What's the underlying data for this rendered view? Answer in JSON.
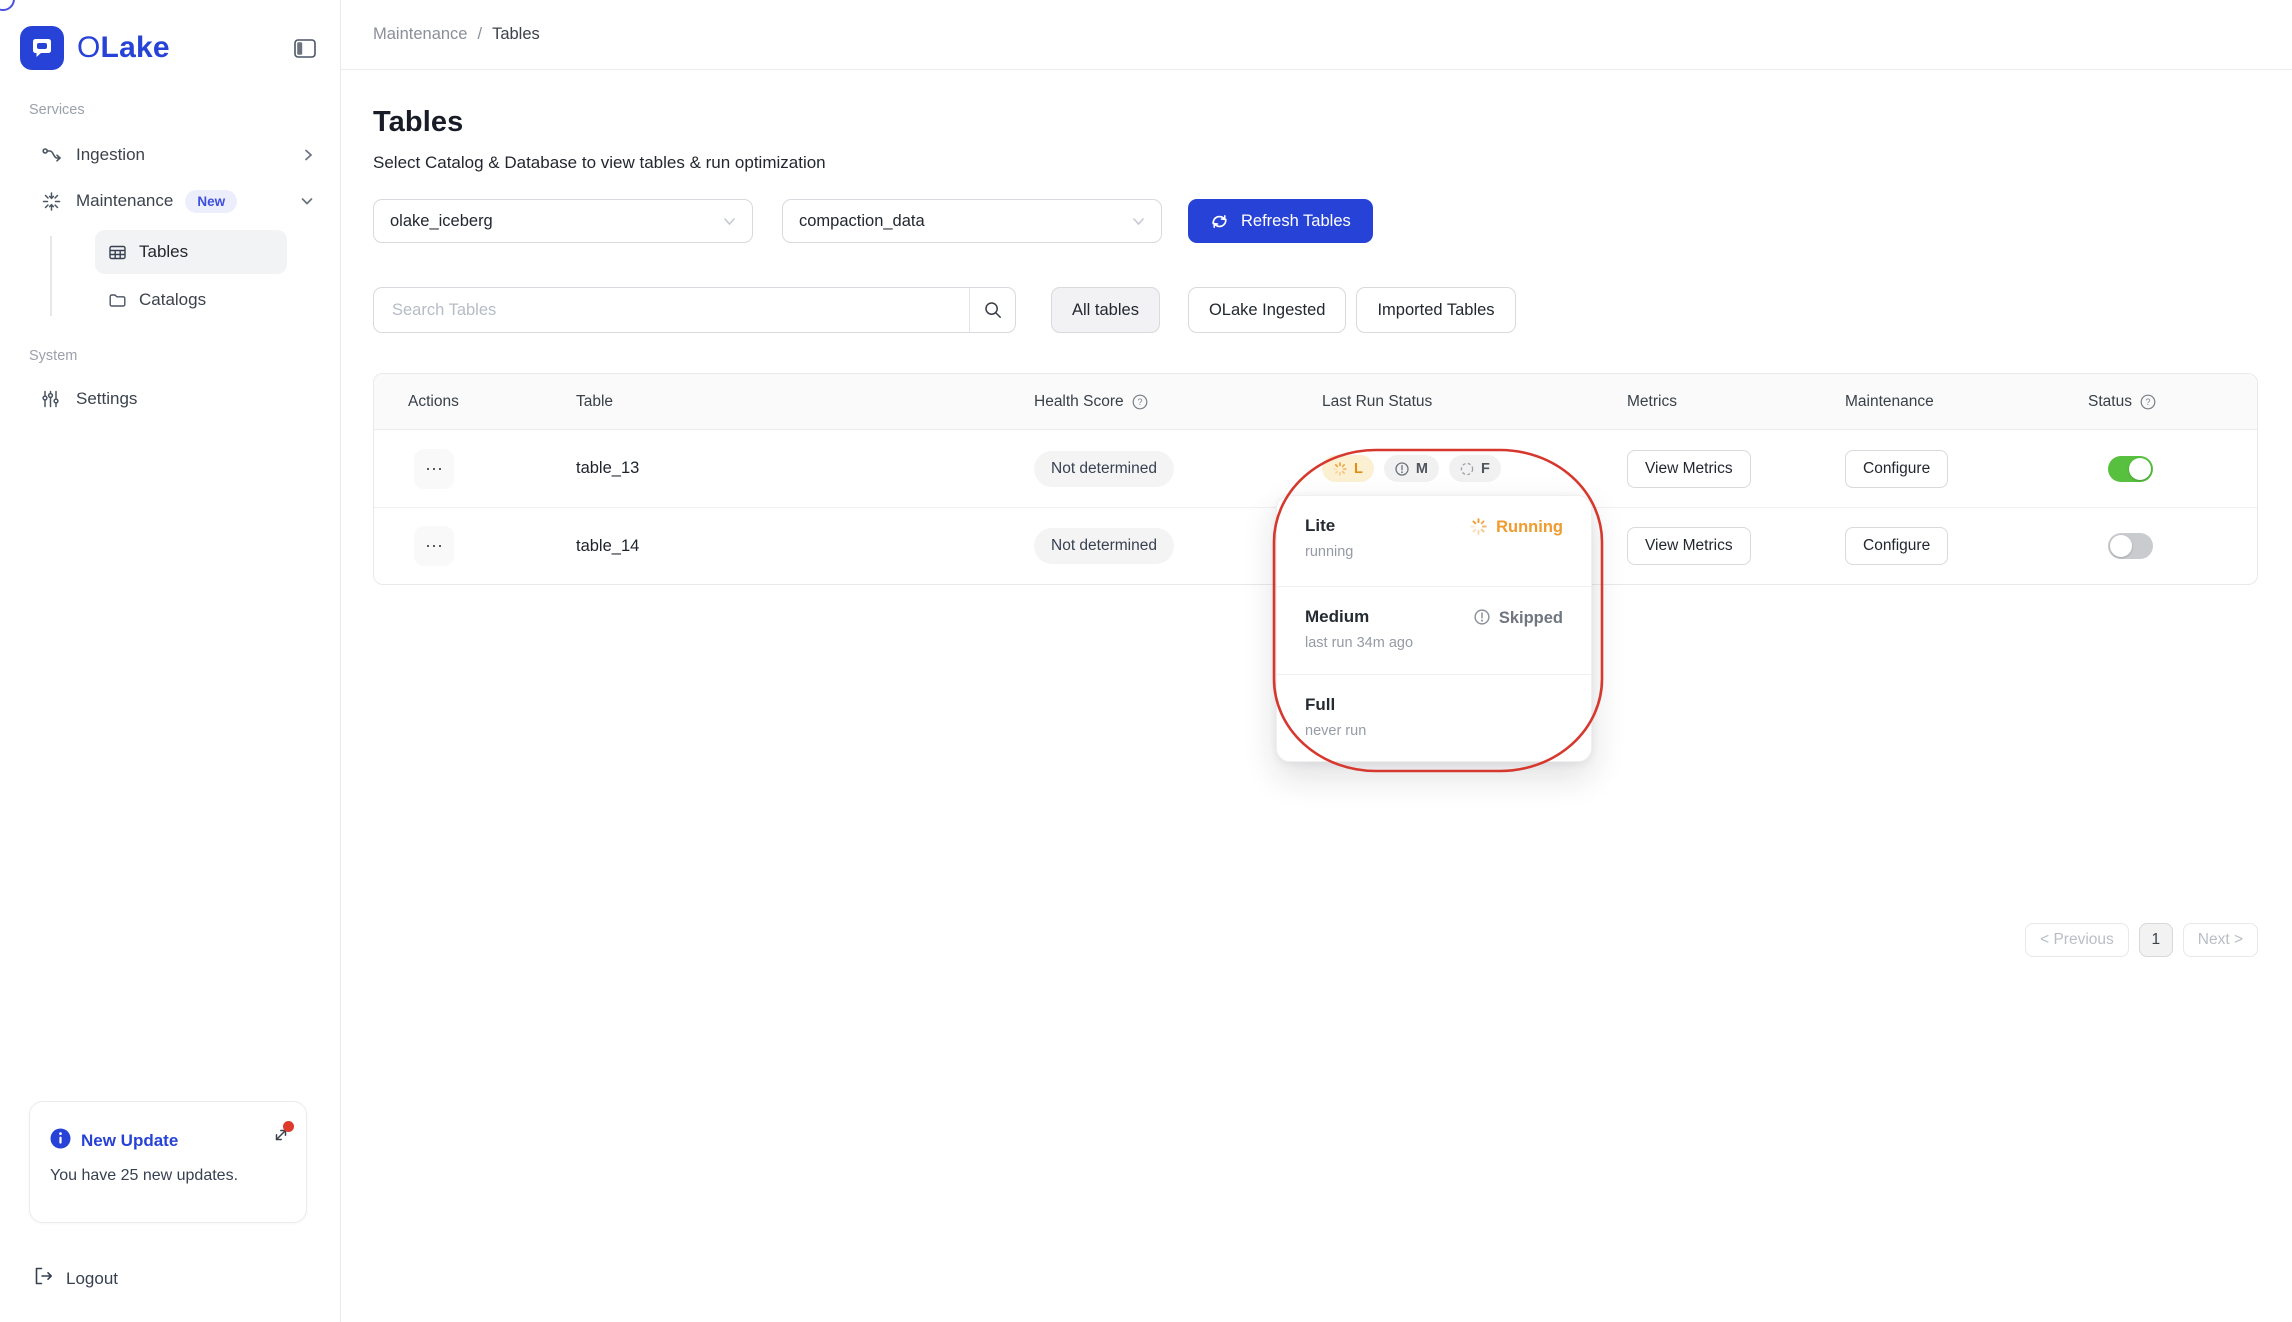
{
  "brand": {
    "name_prefix": "O",
    "name_rest": "Lake",
    "primary_color": "#2742d6"
  },
  "sidebar": {
    "services_label": "Services",
    "system_label": "System",
    "items": {
      "ingestion": "Ingestion",
      "maintenance": "Maintenance",
      "maintenance_badge": "New",
      "tables": "Tables",
      "catalogs": "Catalogs",
      "settings": "Settings"
    },
    "update_card": {
      "title": "New Update",
      "body": "You have 25 new updates."
    },
    "logout_label": "Logout"
  },
  "breadcrumb": {
    "parent": "Maintenance",
    "separator": "/",
    "current": "Tables"
  },
  "page": {
    "title": "Tables",
    "subtitle": "Select Catalog & Database to view tables & run optimization"
  },
  "controls": {
    "catalog_select": "olake_iceberg",
    "database_select": "compaction_data",
    "refresh_button": "Refresh Tables",
    "search_placeholder": "Search Tables",
    "filter_all": "All tables",
    "filter_ingested": "OLake Ingested",
    "filter_imported": "Imported Tables"
  },
  "table": {
    "columns": {
      "actions": "Actions",
      "table": "Table",
      "health": "Health Score",
      "last_run": "Last Run Status",
      "metrics": "Metrics",
      "maintenance": "Maintenance",
      "status": "Status"
    },
    "rows": [
      {
        "actions": "⋯",
        "table": "table_13",
        "health": "Not determined",
        "chips": [
          {
            "label": "L"
          },
          {
            "label": "M"
          },
          {
            "label": "F"
          }
        ],
        "metrics_button": "View Metrics",
        "maintenance_button": "Configure",
        "status_on": true
      },
      {
        "actions": "⋯",
        "table": "table_14",
        "health": "Not determined",
        "metrics_button": "View Metrics",
        "maintenance_button": "Configure",
        "status_on": false
      }
    ]
  },
  "popover": {
    "sections": [
      {
        "title": "Lite",
        "subtitle": "running",
        "status": "Running"
      },
      {
        "title": "Medium",
        "subtitle": "last run 34m ago",
        "status": "Skipped"
      },
      {
        "title": "Full",
        "subtitle": "never run",
        "status": ""
      }
    ]
  },
  "pagination": {
    "previous": "< Previous",
    "page": "1",
    "next": "Next >"
  },
  "colors": {
    "toggle_on": "#57c13f",
    "running_orange": "#ef9b2e",
    "annotation_red": "#d6382e",
    "badge_bg": "#eceefc",
    "badge_text": "#3c4ede"
  }
}
